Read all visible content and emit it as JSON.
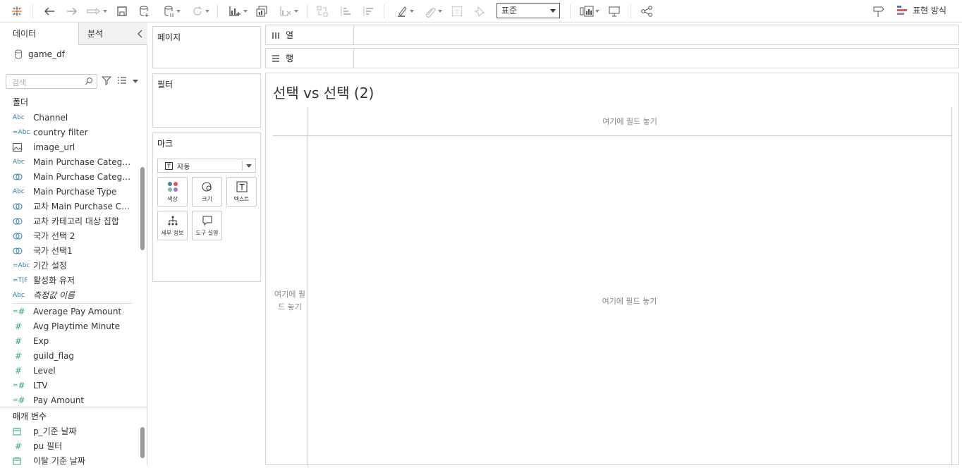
{
  "toolbar": {
    "standard_select": "표준",
    "show_me": "표현 방식"
  },
  "datapane": {
    "tab_data": "데이터",
    "tab_analysis": "분석",
    "source": "game_df",
    "search_placeholder": "검색",
    "folders_header": "폴더",
    "params_header": "매개 변수",
    "dimensions": [
      {
        "type": "Abc",
        "label": "Channel"
      },
      {
        "type": "=Abc",
        "label": "country filter"
      },
      {
        "type": "image",
        "label": "image_url"
      },
      {
        "type": "Abc",
        "label": "Main Purchase Category"
      },
      {
        "type": "set",
        "label": "Main Purchase Categor..."
      },
      {
        "type": "Abc",
        "label": "Main Purchase Type"
      },
      {
        "type": "set",
        "label": "교차 Main Purchase Cat..."
      },
      {
        "type": "set",
        "label": "교차 카테고리 대상 집합"
      },
      {
        "type": "set",
        "label": "국가 선택 2"
      },
      {
        "type": "set",
        "label": "국가 선택1"
      },
      {
        "type": "=Abc",
        "label": "기간 설정"
      },
      {
        "type": "=T|F",
        "label": "활성화 유저"
      },
      {
        "type": "Abc",
        "label": "측정값 이름",
        "italic": true
      }
    ],
    "measures": [
      {
        "type": "=#",
        "label": "Average Pay Amount"
      },
      {
        "type": "#",
        "label": "Avg Playtime Minute"
      },
      {
        "type": "#",
        "label": "Exp"
      },
      {
        "type": "#",
        "label": "guild_flag"
      },
      {
        "type": "#",
        "label": "Level"
      },
      {
        "type": "=#",
        "label": "LTV"
      },
      {
        "type": "=#",
        "label": "Pay Amount"
      }
    ],
    "parameters": [
      {
        "type": "date",
        "label": "p_기준 날짜"
      },
      {
        "type": "#",
        "label": "pu 필터"
      },
      {
        "type": "date",
        "label": "이탈 기준 날짜"
      }
    ]
  },
  "cards": {
    "pages": "페이지",
    "filters": "필터",
    "marks": "마크",
    "marks_type": "자동",
    "mark_buttons": [
      "색상",
      "크기",
      "텍스트",
      "세부 정보",
      "도구 설명"
    ]
  },
  "shelves": {
    "columns": "열",
    "rows": "행"
  },
  "view": {
    "title": "선택 vs 선택 (2)",
    "drop_top": "여기에 필드 놓기",
    "drop_left": "여기에 필드 놓기",
    "drop_main": "여기에 필드 놓기"
  }
}
